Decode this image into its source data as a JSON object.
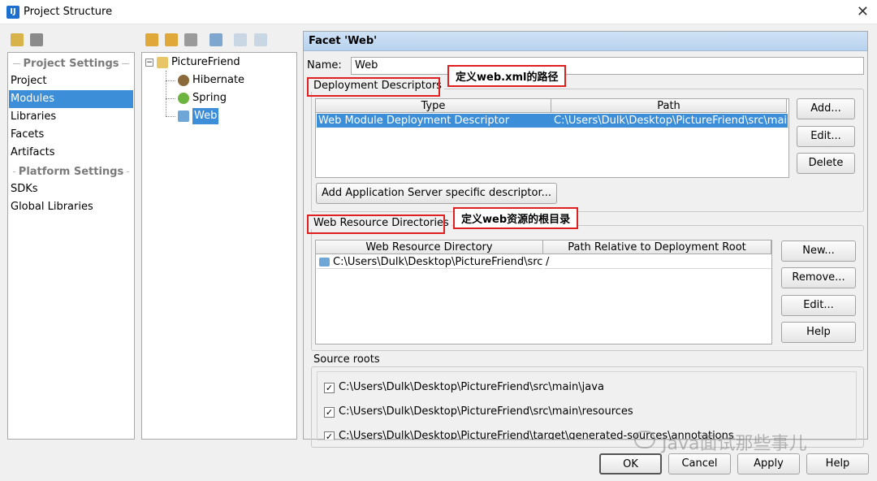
{
  "window": {
    "title": "Project Structure",
    "close": "✕"
  },
  "left_panel": {
    "project_settings": "Project Settings",
    "items_project": [
      "Project",
      "Modules",
      "Libraries",
      "Facets",
      "Artifacts"
    ],
    "platform_settings": "Platform Settings",
    "items_platform": [
      "SDKs",
      "Global Libraries"
    ],
    "selected": "Modules"
  },
  "tree": {
    "root": "PictureFriend",
    "children": [
      "Hibernate",
      "Spring",
      "Web"
    ],
    "selected": "Web"
  },
  "facet": {
    "header": "Facet 'Web'",
    "name_label": "Name:",
    "name_value": "Web",
    "deployment": {
      "title": "Deployment Descriptors",
      "columns": [
        "Type",
        "Path"
      ],
      "rows": [
        [
          "Web Module Deployment Descriptor",
          "C:\\Users\\Dulk\\Desktop\\PictureFriend\\src\\main\\"
        ]
      ],
      "buttons": [
        "Add...",
        "Edit...",
        "Delete"
      ],
      "add_server_button": "Add Application Server specific descriptor..."
    },
    "resources": {
      "title": "Web Resource Directories",
      "columns": [
        "Web Resource Directory",
        "Path Relative to Deployment Root"
      ],
      "rows": [
        [
          "C:\\Users\\Dulk\\Desktop\\PictureFriend\\src...",
          "/"
        ]
      ],
      "buttons": [
        "New...",
        "Remove...",
        "Edit...",
        "Help"
      ]
    },
    "source_roots": {
      "title": "Source roots",
      "items": [
        "C:\\Users\\Dulk\\Desktop\\PictureFriend\\src\\main\\java",
        "C:\\Users\\Dulk\\Desktop\\PictureFriend\\src\\main\\resources",
        "C:\\Users\\Dulk\\Desktop\\PictureFriend\\target\\generated-sources\\annotations"
      ]
    }
  },
  "annotations": {
    "callout1": "定义web.xml的路径",
    "callout2": "定义web资源的根目录"
  },
  "dialog_buttons": [
    "OK",
    "Cancel",
    "Apply",
    "Help"
  ],
  "watermark": "Java面试那些事儿",
  "colors": {
    "selection": "#3c8ed8",
    "annotation_red": "#e02020"
  }
}
